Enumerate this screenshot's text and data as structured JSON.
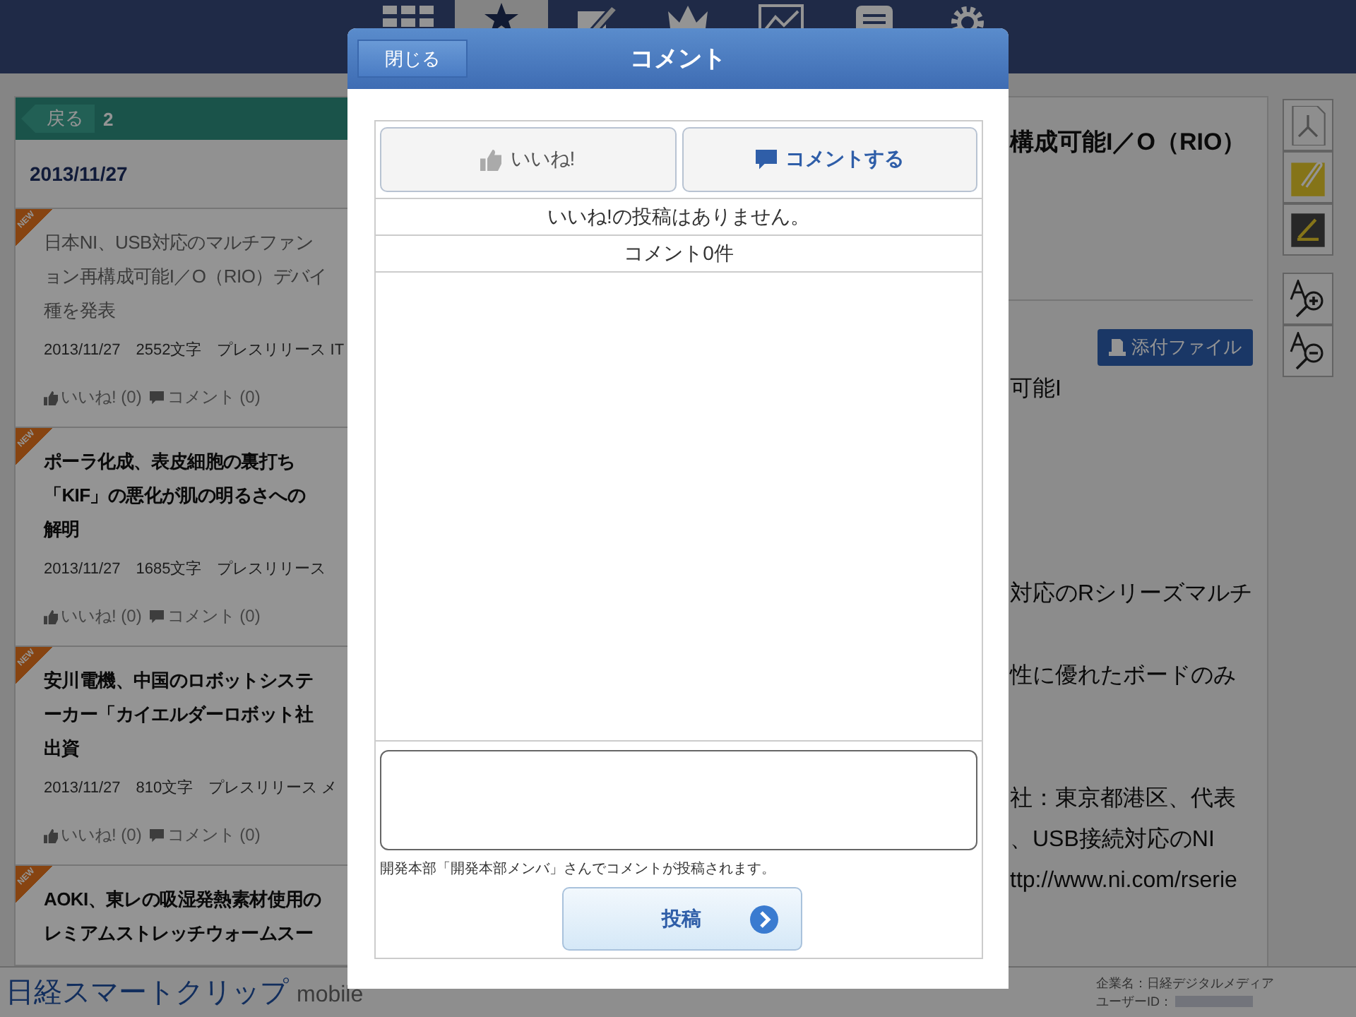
{
  "nav": [
    {
      "kind": "grid",
      "selected": false
    },
    {
      "kind": "star",
      "selected": true
    },
    {
      "kind": "pencil",
      "selected": false
    },
    {
      "kind": "crown",
      "selected": false
    },
    {
      "kind": "chart",
      "selected": false
    },
    {
      "kind": "list",
      "selected": false
    },
    {
      "kind": "gear",
      "selected": false
    }
  ],
  "list_panel": {
    "back_button": "戻る",
    "count": "2",
    "date": "2013/11/27",
    "articles": [
      {
        "badge": "NEW",
        "title_lines": [
          "日本NI、USB対応のマルチファン",
          "ョン再構成可能I／O（RIO）デバイ",
          "種を発表"
        ],
        "read": true,
        "meta": "2013/11/27　2552文字　プレスリリース IT",
        "like": "いいね! (0)",
        "comment": "コメント (0)"
      },
      {
        "badge": "NEW",
        "title_lines": [
          "ポーラ化成、表皮細胞の裏打ち",
          "「KIF」の悪化が肌の明るさへの",
          "解明"
        ],
        "read": false,
        "meta": "2013/11/27　1685文字　プレスリリース",
        "like": "いいね! (0)",
        "comment": "コメント (0)"
      },
      {
        "badge": "NEW",
        "title_lines": [
          "安川電機、中国のロボットシステ",
          "ーカー「カイエルダーロボット社",
          "出資"
        ],
        "read": false,
        "meta": "2013/11/27　810文字　プレスリリース メ",
        "like": "いいね! (0)",
        "comment": "コメント (0)"
      },
      {
        "badge": "NEW",
        "title_lines": [
          "AOKI、東レの吸湿発熱素材使用の",
          "レミアムストレッチウォームスー"
        ],
        "read": false
      }
    ]
  },
  "article": {
    "title": "構成可能I／O（RIO）",
    "attachment_button": "添付ファイル",
    "body_lines": [
      "可能I",
      "対応のRシリーズマルチ",
      "性に優れたボードのみ",
      "社：東京都港区、代表",
      "、USB接続対応のNI",
      "ttp://www.ni.com/rserie"
    ]
  },
  "toolbar": [
    {
      "kind": "pdf"
    },
    {
      "kind": "note"
    },
    {
      "kind": "marker"
    },
    {
      "kind": "zoom-in"
    },
    {
      "kind": "zoom-out"
    }
  ],
  "footer": {
    "logo": "日経スマートクリップ",
    "logo_suffix": "mobile",
    "company": "企業名：日経デジタルメディア",
    "user_id_label": "ユーザーID："
  },
  "modal": {
    "close_button": "閉じる",
    "title": "コメント",
    "like_button": "いいね!",
    "comment_button": "コメントする",
    "likes_status": "いいね!の投稿はありません。",
    "comment_count": "コメント0件",
    "note": "開発本部「開発本部メンバ」さんでコメントが投稿されます。",
    "post_button": "投稿"
  }
}
